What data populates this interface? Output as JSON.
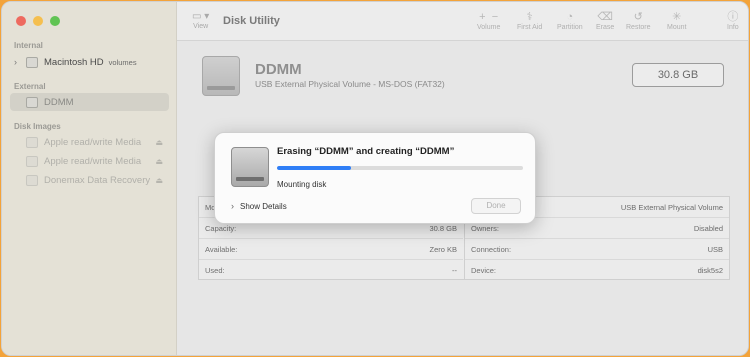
{
  "sidebar": {
    "section_internal": "Internal",
    "internal_items": [
      {
        "label": "Macintosh HD",
        "sub": "volumes"
      }
    ],
    "section_external": "External",
    "external_items": [
      {
        "label": "DDMM"
      }
    ],
    "section_images": "Disk Images",
    "image_items": [
      {
        "label": "Apple read/write Media"
      },
      {
        "label": "Apple read/write Media"
      },
      {
        "label": "Donemax Data Recovery"
      }
    ]
  },
  "toolbar": {
    "title": "Disk Utility",
    "view_label": "View",
    "volume_label": "Volume",
    "first_aid_label": "First Aid",
    "partition_label": "Partition",
    "erase_label": "Erase",
    "restore_label": "Restore",
    "mount_label": "Mount",
    "info_label": "Info",
    "plus_glyph": "+",
    "minus_glyph": "−"
  },
  "volume": {
    "name": "DDMM",
    "description": "USB External Physical Volume - MS-DOS (FAT32)",
    "capacity": "30.8 GB"
  },
  "info_table": {
    "left": [
      {
        "key": "Mo",
        "value": ""
      },
      {
        "key": "Capacity:",
        "value": "30.8 GB"
      },
      {
        "key": "Available:",
        "value": "Zero KB"
      },
      {
        "key": "Used:",
        "value": "--"
      }
    ],
    "right": [
      {
        "key": "",
        "value": "USB External Physical Volume"
      },
      {
        "key": "Owners:",
        "value": "Disabled"
      },
      {
        "key": "Connection:",
        "value": "USB"
      },
      {
        "key": "Device:",
        "value": "disk5s2"
      }
    ]
  },
  "dialog": {
    "title": "Erasing “DDMM” and creating “DDMM”",
    "status": "Mounting disk",
    "progress": 0.3,
    "details_label": "Show Details",
    "done_label": "Done"
  },
  "colors": {
    "accent": "#2f7ef6"
  }
}
